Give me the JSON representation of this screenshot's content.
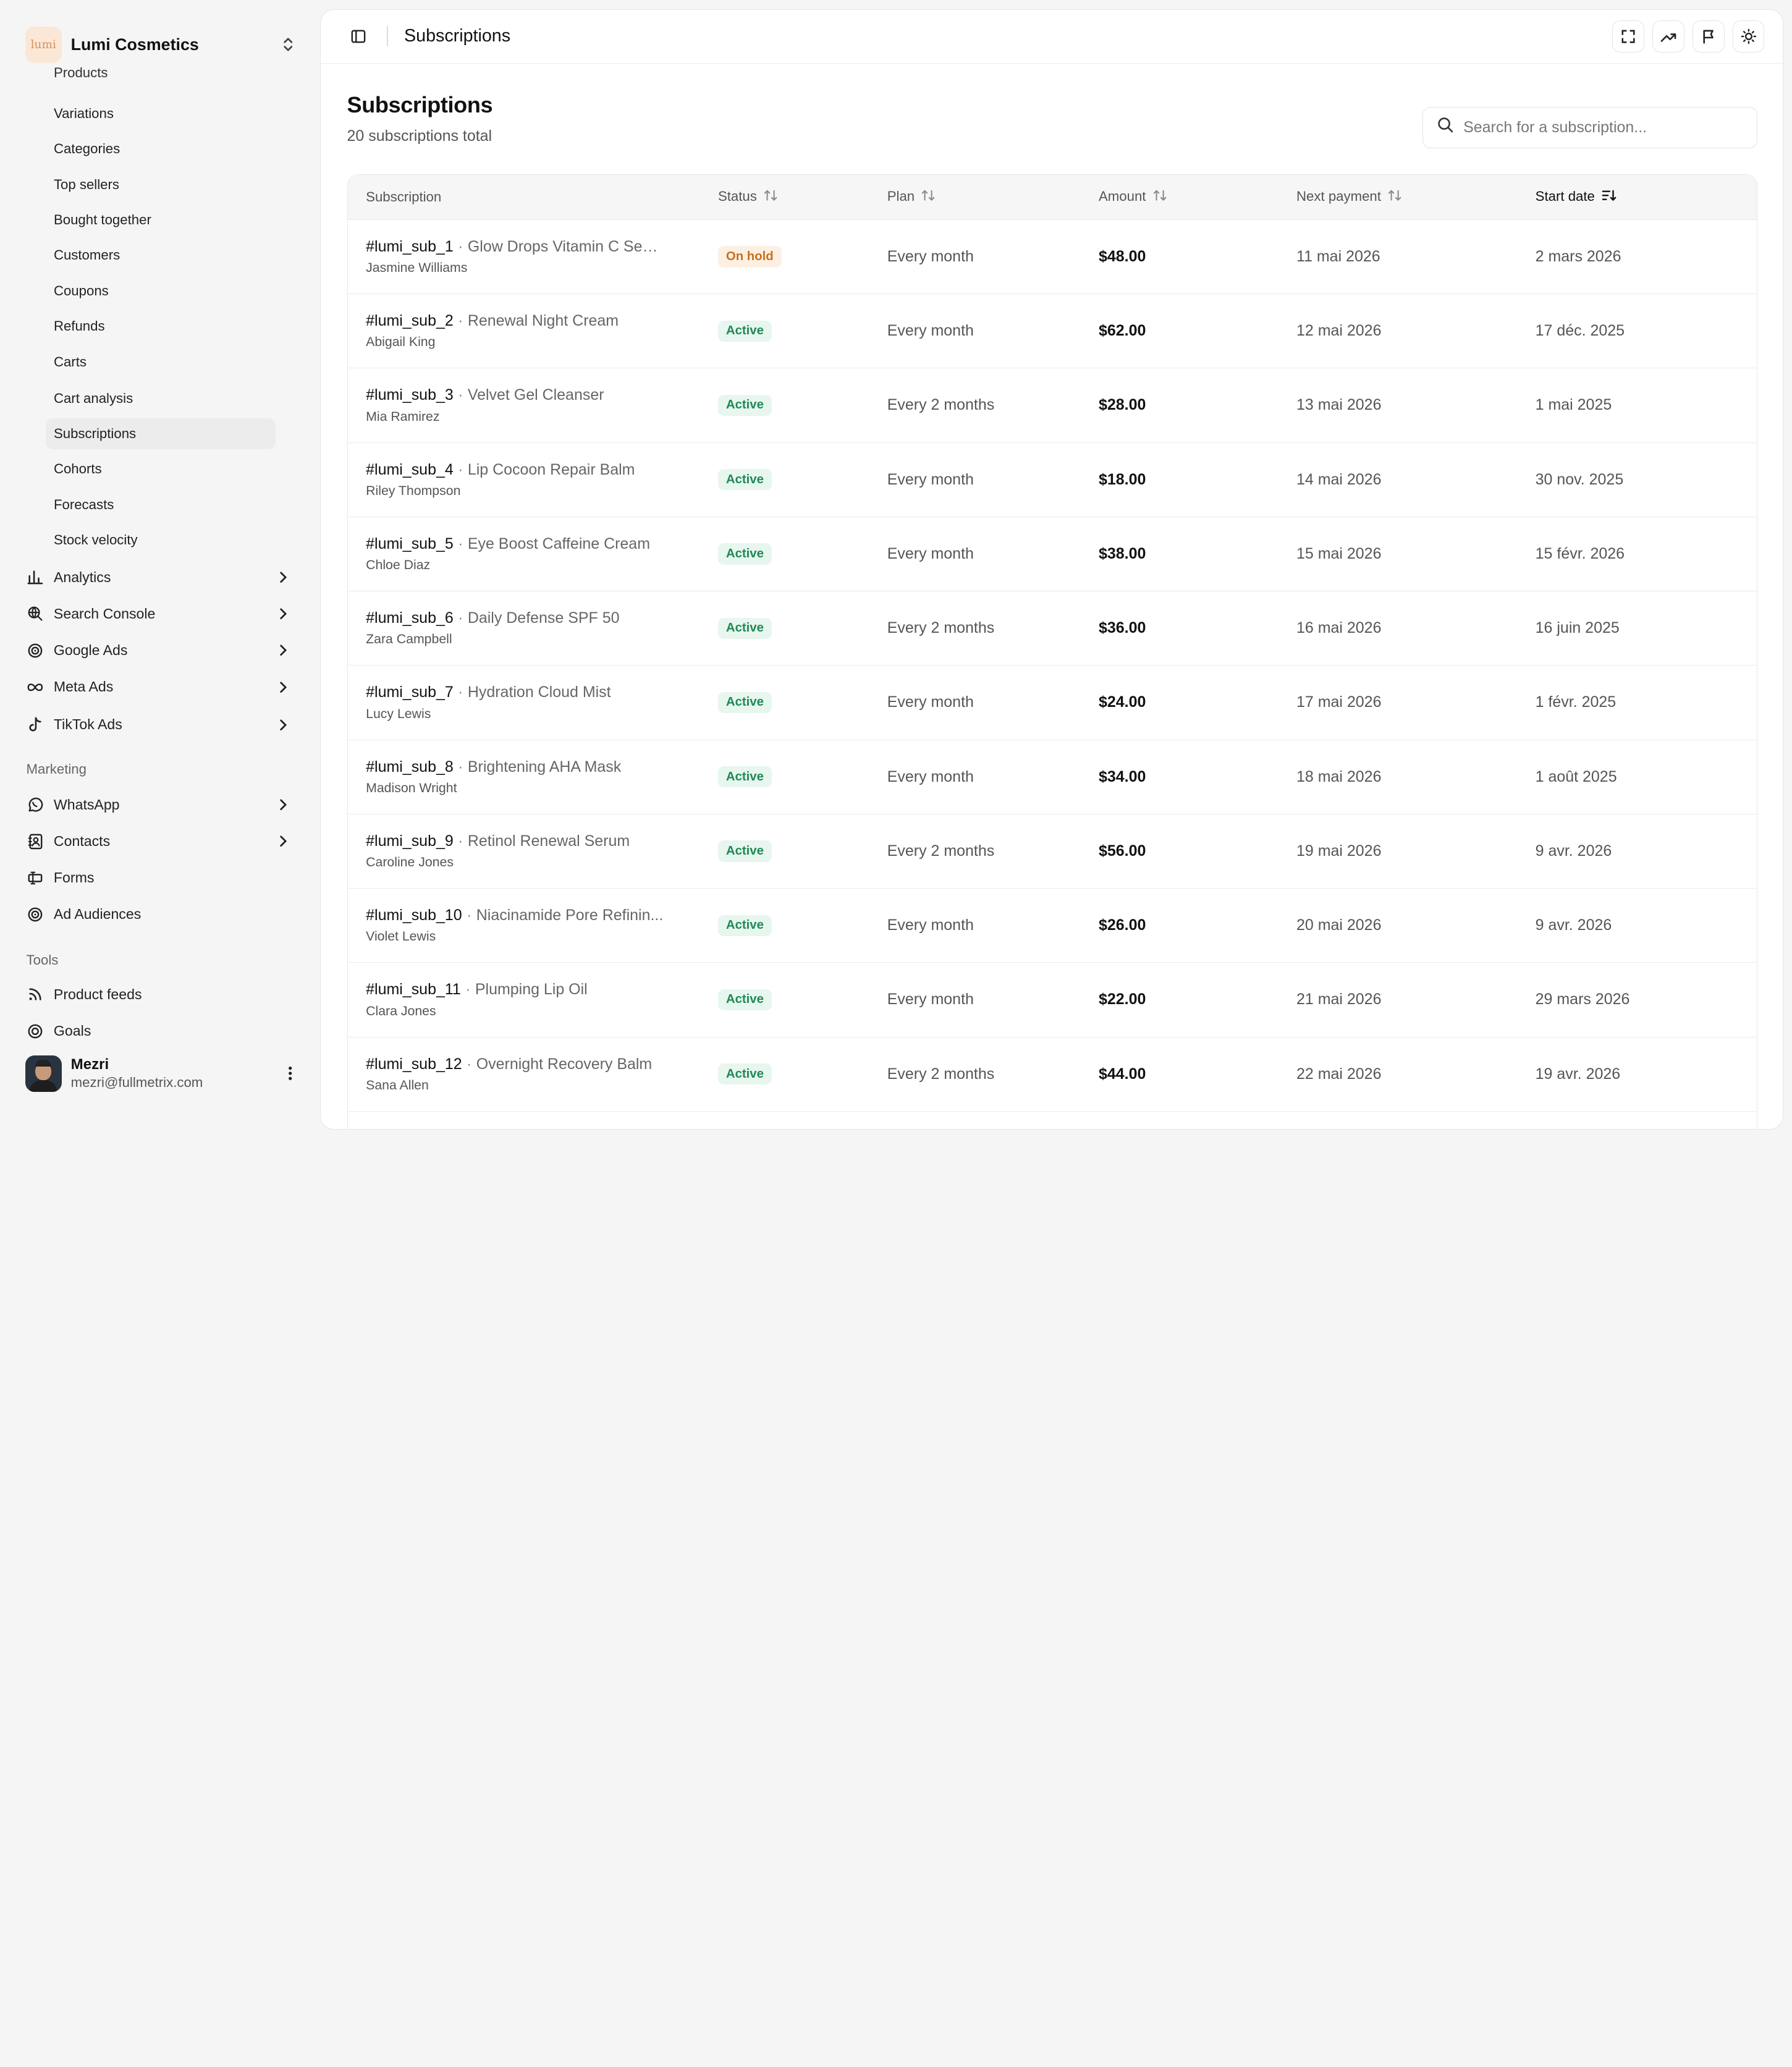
{
  "brand": {
    "logo_text": "lumi",
    "name": "Lumi Cosmetics"
  },
  "sidebar": {
    "sub_items": [
      {
        "label": "Products",
        "active": false
      },
      {
        "label": "Variations",
        "active": false
      },
      {
        "label": "Categories",
        "active": false
      },
      {
        "label": "Top sellers",
        "active": false
      },
      {
        "label": "Bought together",
        "active": false
      },
      {
        "label": "Customers",
        "active": false
      },
      {
        "label": "Coupons",
        "active": false
      },
      {
        "label": "Refunds",
        "active": false
      },
      {
        "label": "Carts",
        "active": false
      },
      {
        "label": "Cart analysis",
        "active": false
      },
      {
        "label": "Subscriptions",
        "active": true
      },
      {
        "label": "Cohorts",
        "active": false
      },
      {
        "label": "Forecasts",
        "active": false
      },
      {
        "label": "Stock velocity",
        "active": false
      }
    ],
    "groups": [
      {
        "label": "Analytics",
        "icon": "bar-chart-icon"
      },
      {
        "label": "Search Console",
        "icon": "search-globe-icon"
      },
      {
        "label": "Google Ads",
        "icon": "target-icon"
      },
      {
        "label": "Meta Ads",
        "icon": "infinity-icon"
      },
      {
        "label": "TikTok Ads",
        "icon": "music-note-icon"
      }
    ],
    "marketing_label": "Marketing",
    "marketing": [
      {
        "label": "WhatsApp",
        "icon": "whatsapp-icon",
        "expandable": true
      },
      {
        "label": "Contacts",
        "icon": "contacts-icon",
        "expandable": true
      },
      {
        "label": "Forms",
        "icon": "form-icon",
        "expandable": false
      },
      {
        "label": "Ad Audiences",
        "icon": "target-icon",
        "expandable": false
      }
    ],
    "tools_label": "Tools",
    "tools": [
      {
        "label": "Product feeds",
        "icon": "rss-icon"
      },
      {
        "label": "Goals",
        "icon": "goal-icon"
      }
    ]
  },
  "user": {
    "name": "Mezri",
    "email": "mezri@fullmetrix.com"
  },
  "header": {
    "title": "Subscriptions"
  },
  "page": {
    "title": "Subscriptions",
    "count": "20 subscriptions total",
    "search_placeholder": "Search for a subscription..."
  },
  "table": {
    "columns": [
      "Subscription",
      "Status",
      "Plan",
      "Amount",
      "Next payment",
      "Start date"
    ],
    "rows": [
      {
        "id": "#lumi_sub_1",
        "product": "Glow Drops Vitamin C Serum",
        "customer": "Jasmine Williams",
        "status": "On hold",
        "plan": "Every month",
        "amount": "$48.00",
        "next": "11 mai 2026",
        "start": "2 mars 2026"
      },
      {
        "id": "#lumi_sub_2",
        "product": "Renewal Night Cream",
        "customer": "Abigail King",
        "status": "Active",
        "plan": "Every month",
        "amount": "$62.00",
        "next": "12 mai 2026",
        "start": "17 déc. 2025"
      },
      {
        "id": "#lumi_sub_3",
        "product": "Velvet Gel Cleanser",
        "customer": "Mia Ramirez",
        "status": "Active",
        "plan": "Every 2 months",
        "amount": "$28.00",
        "next": "13 mai 2026",
        "start": "1 mai 2025"
      },
      {
        "id": "#lumi_sub_4",
        "product": "Lip Cocoon Repair Balm",
        "customer": "Riley Thompson",
        "status": "Active",
        "plan": "Every month",
        "amount": "$18.00",
        "next": "14 mai 2026",
        "start": "30 nov. 2025"
      },
      {
        "id": "#lumi_sub_5",
        "product": "Eye Boost Caffeine Cream",
        "customer": "Chloe Diaz",
        "status": "Active",
        "plan": "Every month",
        "amount": "$38.00",
        "next": "15 mai 2026",
        "start": "15 févr. 2026"
      },
      {
        "id": "#lumi_sub_6",
        "product": "Daily Defense SPF 50",
        "customer": "Zara Campbell",
        "status": "Active",
        "plan": "Every 2 months",
        "amount": "$36.00",
        "next": "16 mai 2026",
        "start": "16 juin 2025"
      },
      {
        "id": "#lumi_sub_7",
        "product": "Hydration Cloud Mist",
        "customer": "Lucy Lewis",
        "status": "Active",
        "plan": "Every month",
        "amount": "$24.00",
        "next": "17 mai 2026",
        "start": "1 févr. 2025"
      },
      {
        "id": "#lumi_sub_8",
        "product": "Brightening AHA Mask",
        "customer": "Madison Wright",
        "status": "Active",
        "plan": "Every month",
        "amount": "$34.00",
        "next": "18 mai 2026",
        "start": "1 août 2025"
      },
      {
        "id": "#lumi_sub_9",
        "product": "Retinol Renewal Serum",
        "customer": "Caroline Jones",
        "status": "Active",
        "plan": "Every 2 months",
        "amount": "$56.00",
        "next": "19 mai 2026",
        "start": "9 avr. 2026"
      },
      {
        "id": "#lumi_sub_10",
        "product": "Niacinamide Pore Refinin...",
        "customer": "Violet Lewis",
        "status": "Active",
        "plan": "Every month",
        "amount": "$26.00",
        "next": "20 mai 2026",
        "start": "9 avr. 2026"
      },
      {
        "id": "#lumi_sub_11",
        "product": "Plumping Lip Oil",
        "customer": "Clara Jones",
        "status": "Active",
        "plan": "Every month",
        "amount": "$22.00",
        "next": "21 mai 2026",
        "start": "29 mars 2026"
      },
      {
        "id": "#lumi_sub_12",
        "product": "Overnight Recovery Balm",
        "customer": "Sana Allen",
        "status": "Active",
        "plan": "Every 2 months",
        "amount": "$44.00",
        "next": "22 mai 2026",
        "start": "19 avr. 2026"
      }
    ]
  },
  "colors": {
    "active_badge": "#1f8a55",
    "hold_badge": "#c7711d",
    "accent": "#111111"
  }
}
